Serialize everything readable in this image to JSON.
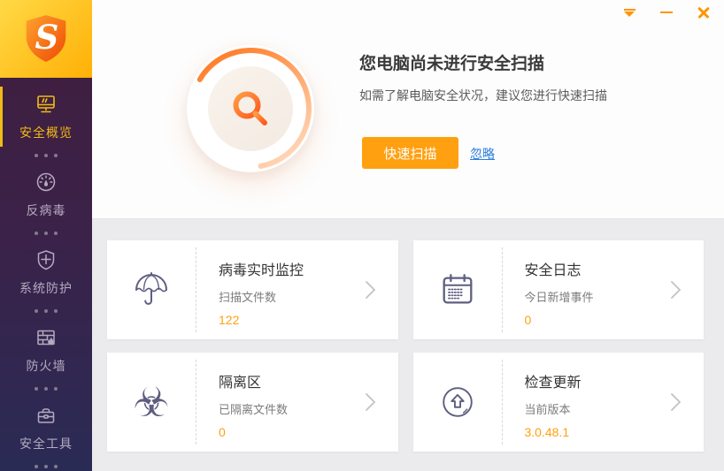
{
  "colors": {
    "accent_orange": "#ffa011",
    "active_yellow": "#f2ba17",
    "link_blue": "#2a7fdd",
    "value_orange": "#ffa010",
    "card_icon": "#5e5e82",
    "titlebar_icon": "#ff9500"
  },
  "sidebar": {
    "logo_icon": "shield-flame-logo",
    "items": [
      {
        "label": "安全概览",
        "icon": "monitor-icon",
        "active": true
      },
      {
        "label": "反病毒",
        "icon": "gauge-icon",
        "active": false
      },
      {
        "label": "系统防护",
        "icon": "shield-cross-icon",
        "active": false
      },
      {
        "label": "防火墙",
        "icon": "firewall-icon",
        "active": false
      },
      {
        "label": "安全工具",
        "icon": "toolbox-icon",
        "active": false
      }
    ]
  },
  "titlebar": {
    "controls": [
      "menu-arrow",
      "minimize",
      "close"
    ]
  },
  "hero": {
    "title": "您电脑尚未进行安全扫描",
    "subtitle": "如需了解电脑安全状况，建议您进行快速扫描",
    "scan_button": "快速扫描",
    "ignore_link": "忽略",
    "circle_icon": "magnifier-scan"
  },
  "cards": [
    {
      "icon": "umbrella-icon",
      "title": "病毒实时监控",
      "label": "扫描文件数",
      "value": "122"
    },
    {
      "icon": "calendar-icon",
      "title": "安全日志",
      "label": "今日新增事件",
      "value": "0"
    },
    {
      "icon": "biohazard-icon",
      "title": "隔离区",
      "label": "已隔离文件数",
      "value": "0"
    },
    {
      "icon": "update-icon",
      "title": "检查更新",
      "label": "当前版本",
      "value": "3.0.48.1"
    }
  ],
  "biohazard_glyph": "☣"
}
